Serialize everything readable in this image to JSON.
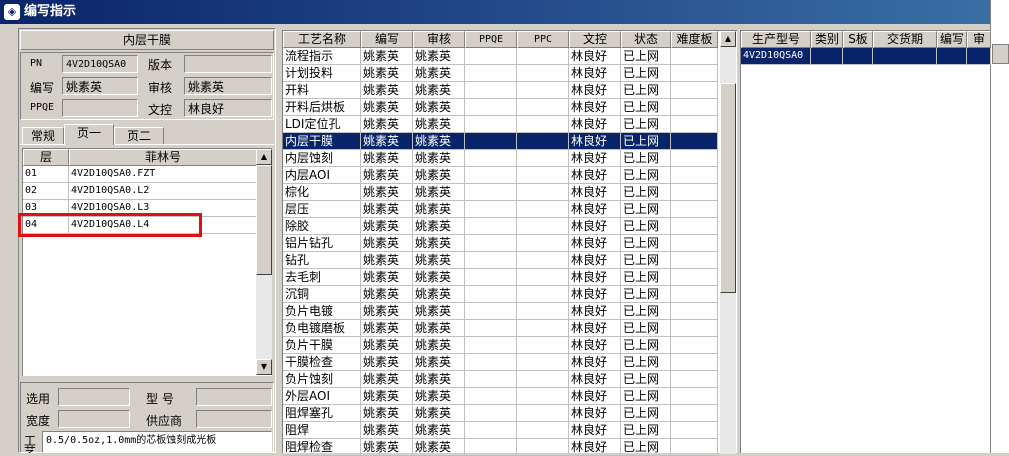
{
  "window": {
    "title": "编写指示"
  },
  "left": {
    "header_title": "内层干膜",
    "fields": {
      "pn": {
        "label": "PN",
        "value": "4V2D10QSA0"
      },
      "version": {
        "label": "版本",
        "value": ""
      },
      "writer": {
        "label": "编写",
        "value": "姚素英"
      },
      "reviewer": {
        "label": "审核",
        "value": "姚素英"
      },
      "ppqe": {
        "label": "PPQE",
        "value": ""
      },
      "doc_control": {
        "label": "文控",
        "value": "林良好"
      }
    },
    "tabs": [
      "常规",
      "页一",
      "页二"
    ],
    "layer_table": {
      "headers": [
        "层",
        "菲林号"
      ],
      "rows": [
        [
          "01",
          "4V2D10QSA0.FZT"
        ],
        [
          "02",
          "4V2D10QSA0.L2"
        ],
        [
          "03",
          "4V2D10QSA0.L3"
        ],
        [
          "04",
          "4V2D10QSA0.L4"
        ]
      ]
    },
    "bottom": {
      "select_label": "选用",
      "model_label": "型 号",
      "width_label": "宽度",
      "supplier_label": "供应商",
      "note_label": "工艺",
      "note_text": "0.5/0.5oz,1.0mm的芯板蚀刻成光板"
    }
  },
  "process_table": {
    "headers": [
      "工艺名称",
      "编写",
      "审核",
      "PPQE",
      "PPC",
      "文控",
      "状态",
      "难度板"
    ],
    "selected_index": 5,
    "rows": [
      [
        "流程指示",
        "姚素英",
        "姚素英",
        "",
        "",
        "林良好",
        "已上网",
        ""
      ],
      [
        "计划投料",
        "姚素英",
        "姚素英",
        "",
        "",
        "林良好",
        "已上网",
        ""
      ],
      [
        "开料",
        "姚素英",
        "姚素英",
        "",
        "",
        "林良好",
        "已上网",
        ""
      ],
      [
        "开料后烘板",
        "姚素英",
        "姚素英",
        "",
        "",
        "林良好",
        "已上网",
        ""
      ],
      [
        "LDI定位孔",
        "姚素英",
        "姚素英",
        "",
        "",
        "林良好",
        "已上网",
        ""
      ],
      [
        "内层干膜",
        "姚素英",
        "姚素英",
        "",
        "",
        "林良好",
        "已上网",
        ""
      ],
      [
        "内层蚀刻",
        "姚素英",
        "姚素英",
        "",
        "",
        "林良好",
        "已上网",
        ""
      ],
      [
        "内层AOI",
        "姚素英",
        "姚素英",
        "",
        "",
        "林良好",
        "已上网",
        ""
      ],
      [
        "棕化",
        "姚素英",
        "姚素英",
        "",
        "",
        "林良好",
        "已上网",
        ""
      ],
      [
        "层压",
        "姚素英",
        "姚素英",
        "",
        "",
        "林良好",
        "已上网",
        ""
      ],
      [
        "除胶",
        "姚素英",
        "姚素英",
        "",
        "",
        "林良好",
        "已上网",
        ""
      ],
      [
        "铝片钻孔",
        "姚素英",
        "姚素英",
        "",
        "",
        "林良好",
        "已上网",
        ""
      ],
      [
        "钻孔",
        "姚素英",
        "姚素英",
        "",
        "",
        "林良好",
        "已上网",
        ""
      ],
      [
        "去毛刺",
        "姚素英",
        "姚素英",
        "",
        "",
        "林良好",
        "已上网",
        ""
      ],
      [
        "沉铜",
        "姚素英",
        "姚素英",
        "",
        "",
        "林良好",
        "已上网",
        ""
      ],
      [
        "负片电镀",
        "姚素英",
        "姚素英",
        "",
        "",
        "林良好",
        "已上网",
        ""
      ],
      [
        "负电镀磨板",
        "姚素英",
        "姚素英",
        "",
        "",
        "林良好",
        "已上网",
        ""
      ],
      [
        "负片干膜",
        "姚素英",
        "姚素英",
        "",
        "",
        "林良好",
        "已上网",
        ""
      ],
      [
        "干膜检查",
        "姚素英",
        "姚素英",
        "",
        "",
        "林良好",
        "已上网",
        ""
      ],
      [
        "负片蚀刻",
        "姚素英",
        "姚素英",
        "",
        "",
        "林良好",
        "已上网",
        ""
      ],
      [
        "外层AOI",
        "姚素英",
        "姚素英",
        "",
        "",
        "林良好",
        "已上网",
        ""
      ],
      [
        "阻焊塞孔",
        "姚素英",
        "姚素英",
        "",
        "",
        "林良好",
        "已上网",
        ""
      ],
      [
        "阻焊",
        "姚素英",
        "姚素英",
        "",
        "",
        "林良好",
        "已上网",
        ""
      ],
      [
        "阻焊检查",
        "姚素英",
        "姚素英",
        "",
        "",
        "林良好",
        "已上网",
        ""
      ]
    ]
  },
  "production_table": {
    "headers": [
      "生产型号",
      "类别",
      "S板",
      "交货期",
      "编写",
      "审"
    ],
    "rows": [
      [
        "4V2D10QSA0",
        "",
        "",
        "",
        "",
        ""
      ]
    ]
  },
  "colors": {
    "selection": "#0a246a",
    "highlight_box": "#e01010",
    "title_start": "#0a246a",
    "title_end": "#3a6ea5"
  }
}
